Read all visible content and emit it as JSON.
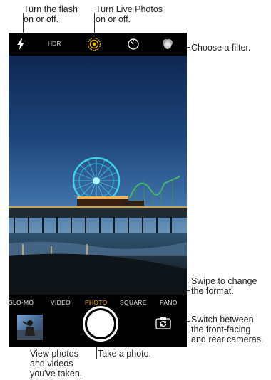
{
  "callouts": {
    "flash": "Turn the flash\non or off.",
    "live": "Turn Live Photos\non or off.",
    "filter": "Choose a filter.",
    "format": "Swipe to change\nthe format.",
    "switch": "Switch between\nthe front-facing\nand rear cameras.",
    "library": "View photos\nand videos\nyou've taken.",
    "take": "Take a photo."
  },
  "camera": {
    "hdr_label": "HDR",
    "modes": [
      {
        "label": "SLO-MO",
        "active": false
      },
      {
        "label": "VIDEO",
        "active": false
      },
      {
        "label": "PHOTO",
        "active": true
      },
      {
        "label": "SQUARE",
        "active": false
      },
      {
        "label": "PANO",
        "active": false
      }
    ]
  },
  "colors": {
    "active_mode": "#f2b400",
    "live_photos": "#f2b400"
  },
  "icons": [
    "flash-icon",
    "live-photos-icon",
    "timer-icon",
    "filters-icon",
    "camera-switch-icon"
  ]
}
